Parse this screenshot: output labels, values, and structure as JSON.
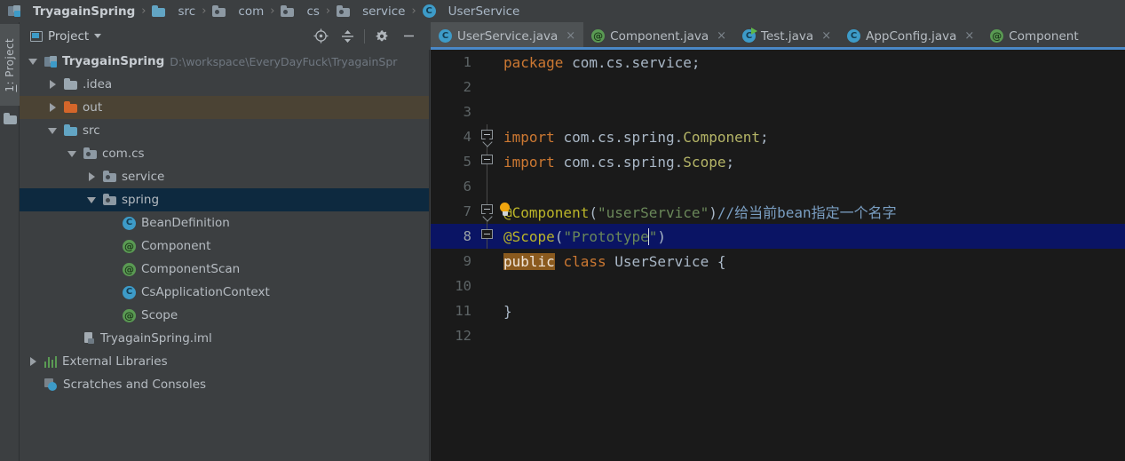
{
  "breadcrumb": [
    {
      "label": "TryagainSpring",
      "icon": "module-icon",
      "root": true
    },
    {
      "label": "src",
      "icon": "folder-icon"
    },
    {
      "label": "com",
      "icon": "package-icon"
    },
    {
      "label": "cs",
      "icon": "package-icon"
    },
    {
      "label": "service",
      "icon": "package-icon"
    },
    {
      "label": "UserService",
      "icon": "class-icon"
    }
  ],
  "left_rail": {
    "tab_prefix": "1",
    "tab_label": ": Project",
    "folder_icon": "folder-icon"
  },
  "project_panel": {
    "title": "Project",
    "title_icon": "project-window-icon",
    "dropdown_icon": "chevron-down-icon",
    "tools": [
      {
        "name": "locate-file-icon",
        "title": "Select Opened File"
      },
      {
        "name": "collapse-all-icon",
        "title": "Collapse All"
      },
      {
        "name": "gear-icon",
        "title": "Settings"
      },
      {
        "name": "minimize-icon",
        "title": "Hide"
      }
    ],
    "tree": [
      {
        "id": "root",
        "label": "TryagainSpring",
        "path": "D:\\workspace\\EveryDayFuck\\TryagainSpr",
        "icon": "module-icon",
        "twisty": "expanded",
        "indent": 0,
        "bold": true
      },
      {
        "id": "idea",
        "label": ".idea",
        "icon": "folder-icon-gray",
        "twisty": "collapsed",
        "indent": 1
      },
      {
        "id": "out",
        "label": "out",
        "icon": "folder-icon-orange",
        "twisty": "collapsed",
        "indent": 1,
        "state": "excluded"
      },
      {
        "id": "src",
        "label": "src",
        "icon": "folder-icon-blue",
        "twisty": "expanded",
        "indent": 1
      },
      {
        "id": "comcs",
        "label": "com.cs",
        "icon": "package-icon",
        "twisty": "expanded",
        "indent": 2
      },
      {
        "id": "service",
        "label": "service",
        "icon": "package-icon",
        "twisty": "collapsed",
        "indent": 3
      },
      {
        "id": "spring",
        "label": "spring",
        "icon": "package-icon",
        "twisty": "expanded",
        "indent": 3,
        "state": "selected"
      },
      {
        "id": "beandefinition",
        "label": "BeanDefinition",
        "icon": "class-icon",
        "twisty": "none",
        "indent": 4
      },
      {
        "id": "component",
        "label": "Component",
        "icon": "annotation-icon",
        "twisty": "none",
        "indent": 4
      },
      {
        "id": "componentscan",
        "label": "ComponentScan",
        "icon": "annotation-icon",
        "twisty": "none",
        "indent": 4
      },
      {
        "id": "csapplicationcontext",
        "label": "CsApplicationContext",
        "icon": "class-icon",
        "twisty": "none",
        "indent": 4
      },
      {
        "id": "scope",
        "label": "Scope",
        "icon": "annotation-icon",
        "twisty": "none",
        "indent": 4
      },
      {
        "id": "iml",
        "label": "TryagainSpring.iml",
        "icon": "iml-file-icon",
        "twisty": "none",
        "indent": 2
      },
      {
        "id": "extlibs",
        "label": "External Libraries",
        "icon": "library-icon",
        "twisty": "collapsed",
        "indent": 0
      },
      {
        "id": "scratches",
        "label": "Scratches and Consoles",
        "icon": "scratch-icon",
        "twisty": "none",
        "indent": 0
      }
    ]
  },
  "editor": {
    "tabs": [
      {
        "label": "UserService.java",
        "icon": "class-icon",
        "active": true,
        "close_icon": "close-icon"
      },
      {
        "label": "Component.java",
        "icon": "annotation-icon",
        "active": false,
        "close_icon": "close-icon"
      },
      {
        "label": "Test.java",
        "icon": "class-run-icon",
        "active": false,
        "close_icon": "close-icon"
      },
      {
        "label": "AppConfig.java",
        "icon": "class-icon",
        "active": false,
        "close_icon": "close-icon"
      },
      {
        "label": "Component",
        "icon": "annotation-icon",
        "active": false,
        "close_icon": ""
      }
    ],
    "lines": [
      {
        "n": "1",
        "fold": "none",
        "tokens": [
          {
            "t": "package ",
            "c": "k-kw"
          },
          {
            "t": "com.cs.service;",
            "c": "k-pl"
          }
        ]
      },
      {
        "n": "2",
        "fold": "none",
        "tokens": []
      },
      {
        "n": "3",
        "fold": "none",
        "tokens": []
      },
      {
        "n": "4",
        "fold": "tip",
        "tokens": [
          {
            "t": "import ",
            "c": "k-kw"
          },
          {
            "t": "com.cs.spring.",
            "c": "k-pl"
          },
          {
            "t": "Component",
            "c": "k-cls"
          },
          {
            "t": ";",
            "c": "k-pl"
          }
        ]
      },
      {
        "n": "5",
        "fold": "flat",
        "tokens": [
          {
            "t": "import ",
            "c": "k-kw"
          },
          {
            "t": "com.cs.spring.",
            "c": "k-pl"
          },
          {
            "t": "Scope",
            "c": "k-cls"
          },
          {
            "t": ";",
            "c": "k-pl"
          }
        ]
      },
      {
        "n": "6",
        "fold": "none",
        "tokens": []
      },
      {
        "n": "7",
        "fold": "tip",
        "bulb": true,
        "tokens": [
          {
            "t": "@Component",
            "c": "k-anno"
          },
          {
            "t": "(",
            "c": "k-pl"
          },
          {
            "t": "\"userService\"",
            "c": "k-str"
          },
          {
            "t": ")",
            "c": "k-pl"
          },
          {
            "t": "//给当前bean指定一个名字",
            "c": "k-cmt"
          }
        ]
      },
      {
        "n": "8",
        "fold": "flat",
        "current": true,
        "tokens": [
          {
            "t": "@Scope",
            "c": "k-anno"
          },
          {
            "t": "(",
            "c": "k-pl"
          },
          {
            "t": "\"Prototype",
            "c": "k-str"
          },
          {
            "t": "",
            "c": "caret"
          },
          {
            "t": "\"",
            "c": "k-str"
          },
          {
            "t": ")",
            "c": "k-pl"
          }
        ]
      },
      {
        "n": "9",
        "fold": "none",
        "tokens": [
          {
            "t": "public",
            "c": "hl-search"
          },
          {
            "t": " ",
            "c": "k-pl"
          },
          {
            "t": "class ",
            "c": "k-kw"
          },
          {
            "t": "UserService ",
            "c": "k-type"
          },
          {
            "t": "{",
            "c": "k-pl"
          }
        ]
      },
      {
        "n": "10",
        "fold": "none",
        "tokens": []
      },
      {
        "n": "11",
        "fold": "none",
        "tokens": [
          {
            "t": "}",
            "c": "k-pl"
          }
        ]
      },
      {
        "n": "12",
        "fold": "none",
        "tokens": []
      }
    ]
  },
  "colors": {
    "panel_bg": "#3c3f41",
    "editor_bg": "#1a1a1a",
    "selection_blue": "#0d293f",
    "current_line": "#0a1464",
    "excluded_row": "#4b4334",
    "accent_blue": "#4a88c7",
    "annotation_yellow": "#bbb529",
    "keyword_orange": "#cc7832",
    "string_green": "#6a8759",
    "comment_blue": "#7a9ec2",
    "search_highlight": "#8a5a1e"
  }
}
